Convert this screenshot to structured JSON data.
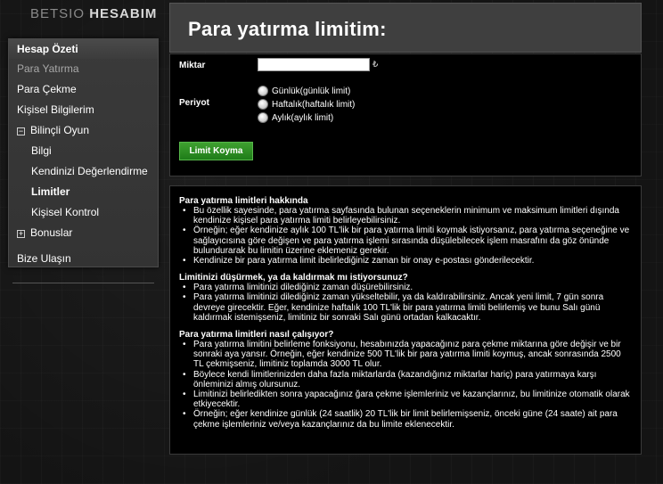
{
  "logo": {
    "part1": "BETSIO",
    "part2": "HESABIM"
  },
  "sidebar": {
    "header": "Hesap Özeti",
    "items": [
      {
        "label": "Para Yatırma",
        "active": true
      },
      {
        "label": "Para Çekme"
      },
      {
        "label": "Kişisel Bilgilerim"
      },
      {
        "label": "Bilinçli Oyun",
        "toggle": "−"
      },
      {
        "label": "Bilgi"
      },
      {
        "label": "Kendinizi Değerlendirme"
      },
      {
        "label": "Limitler"
      },
      {
        "label": "Kişisel Kontrol"
      },
      {
        "label": "Bonuslar",
        "toggle": "+"
      },
      {
        "label": "Bize Ulaşın"
      }
    ]
  },
  "page": {
    "title": "Para yatırma limitim:"
  },
  "form": {
    "amount_label": "Miktar",
    "amount_value": "",
    "currency_symbol": "₺",
    "period_label": "Periyot",
    "periods": [
      "Günlük(günlük limit)",
      "Haftalık(haftalık limit)",
      "Aylık(aylık limit)"
    ],
    "submit_label": "Limit Koyma"
  },
  "info": {
    "sections": [
      {
        "title": "Para yatırma limitleri hakkında",
        "bullets": [
          "Bu özellik sayesinde, para yatırma sayfasında bulunan seçeneklerin minimum ve maksimum limitleri dışında kendinize kişisel para yatırma limiti belirleyebilirsiniz.",
          "Örneğin; eğer kendinize aylık 100 TL'lik bir para yatırma limiti koymak istiyorsanız, para yatırma seçeneğine ve sağlayıcısına göre değişen ve para yatırma işlemi sırasında düşülebilecek işlem masrafını da göz önünde bulundurarak bu limitin üzerine eklemeniz gerekir.",
          "Kendinize bir para yatırma limit ibelirlediğiniz zaman bir onay e-postası gönderilecektir."
        ]
      },
      {
        "title": "Limitinizi düşürmek, ya da kaldırmak mı istiyorsunuz?",
        "bullets": [
          "Para yatırma limitinizi dilediğiniz zaman düşürebilirsiniz.",
          "Para yatırma limitinizi dilediğiniz zaman yükseltebilir, ya da kaldırabilirsiniz. Ancak yeni limit, 7 gün sonra devreye girecektir. Eğer, kendinize haftalık 100 TL'lik bir para yatırma limiti belirlemiş ve bunu Salı günü kaldırmak istemişseniz, limitiniz bir sonraki Salı günü ortadan kalkacaktır."
        ]
      },
      {
        "title": "Para yatırma limitleri nasıl çalışıyor?",
        "bullets": [
          "Para yatırma limitini belirleme fonksiyonu, hesabınızda yapacağınız para çekme miktarına göre değişir ve bir sonraki aya yansır. Örneğin, eğer kendinize 500 TL'lik bir para yatırma limiti koymuş, ancak sonrasında 2500 TL çekmişseniz, limitiniz toplamda 3000 TL olur.",
          "Böylece kendi limitlerinizden daha fazla miktarlarda (kazandığınız miktarlar hariç) para yatırmaya karşı önleminizi almış olursunuz.",
          "Limitinizi belirledikten sonra yapacağınız ğara çekme işlemleriniz ve kazançlarınız, bu limitinize otomatik olarak etkiyecektir.",
          "Örneğin; eğer kendinize günlük (24 saatlik) 20 TL'lik bir limit belirlemişseniz, önceki güne (24 saate) ait para çekme işlemleriniz ve/veya kazançlarınız da bu limite eklenecektir."
        ]
      }
    ]
  }
}
